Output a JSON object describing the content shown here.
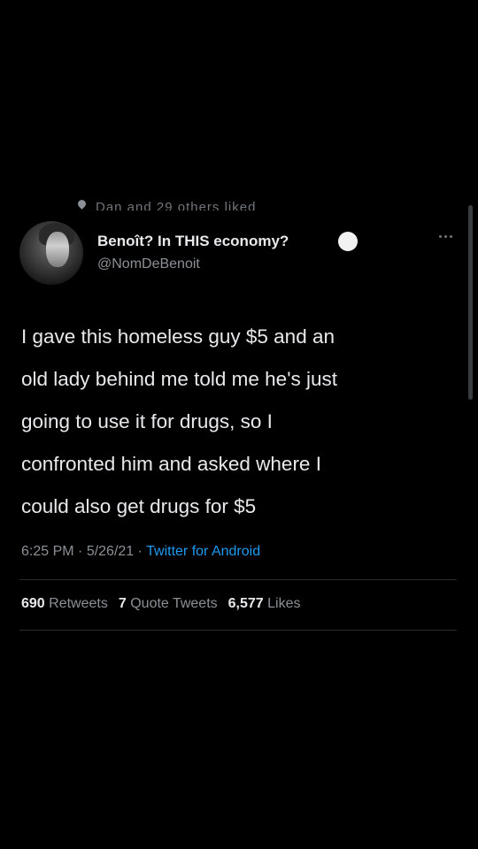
{
  "social_context": {
    "text": "Dan and 29 others liked",
    "icon": "heart-icon"
  },
  "tweet": {
    "display_name": "Benoît? In THIS economy?",
    "verified_badge_icon": "white-circle-icon",
    "handle": "@NomDeBenoit",
    "text_lines": [
      "I gave this homeless guy $5 and an",
      "old lady behind me told me he's just",
      "going to use it for drugs, so I",
      "confronted him and asked where I",
      "could also get drugs for $5"
    ],
    "time": "6:25 PM",
    "date": "5/26/21",
    "source": "Twitter for Android",
    "separator": " · "
  },
  "stats": {
    "retweets_count": "690",
    "retweets_label": "Retweets",
    "quotes_count": "7",
    "quotes_label": "Quote Tweets",
    "likes_count": "6,577",
    "likes_label": "Likes"
  },
  "colors": {
    "background": "#000000",
    "primary_text": "#e7e9ea",
    "secondary_text": "#8b9096",
    "link": "#1d9bf0"
  }
}
